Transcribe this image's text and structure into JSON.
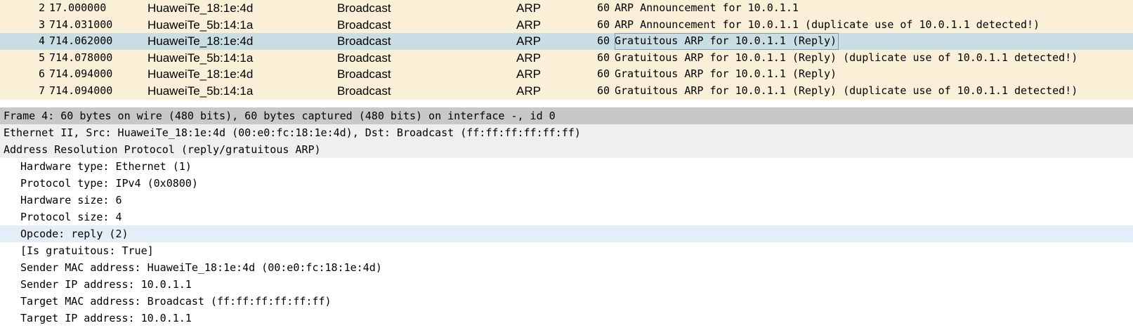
{
  "packets": [
    {
      "no": "2",
      "time": "17.000000",
      "source": "HuaweiTe_18:1e:4d",
      "destination": "Broadcast",
      "protocol": "ARP",
      "length": "60",
      "info": "ARP Announcement for 10.0.1.1",
      "selected": false
    },
    {
      "no": "3",
      "time": "714.031000",
      "source": "HuaweiTe_5b:14:1a",
      "destination": "Broadcast",
      "protocol": "ARP",
      "length": "60",
      "info": "ARP Announcement for 10.0.1.1 (duplicate use of 10.0.1.1 detected!)",
      "selected": false
    },
    {
      "no": "4",
      "time": "714.062000",
      "source": "HuaweiTe_18:1e:4d",
      "destination": "Broadcast",
      "protocol": "ARP",
      "length": "60",
      "info": "Gratuitous ARP for 10.0.1.1 (Reply)",
      "selected": true
    },
    {
      "no": "5",
      "time": "714.078000",
      "source": "HuaweiTe_5b:14:1a",
      "destination": "Broadcast",
      "protocol": "ARP",
      "length": "60",
      "info": "Gratuitous ARP for 10.0.1.1 (Reply) (duplicate use of 10.0.1.1 detected!)",
      "selected": false
    },
    {
      "no": "6",
      "time": "714.094000",
      "source": "HuaweiTe_18:1e:4d",
      "destination": "Broadcast",
      "protocol": "ARP",
      "length": "60",
      "info": "Gratuitous ARP for 10.0.1.1 (Reply)",
      "selected": false
    },
    {
      "no": "7",
      "time": "714.094000",
      "source": "HuaweiTe_5b:14:1a",
      "destination": "Broadcast",
      "protocol": "ARP",
      "length": "60",
      "info": "Gratuitous ARP for 10.0.1.1 (Reply) (duplicate use of 10.0.1.1 detected!)",
      "selected": false
    }
  ],
  "details": {
    "frame": "Frame 4: 60 bytes on wire (480 bits), 60 bytes captured (480 bits) on interface -, id 0",
    "ethernet": "Ethernet II, Src: HuaweiTe_18:1e:4d (00:e0:fc:18:1e:4d), Dst: Broadcast (ff:ff:ff:ff:ff:ff)",
    "arp": "Address Resolution Protocol (reply/gratuitous ARP)",
    "fields": [
      {
        "text": "Hardware type: Ethernet (1)",
        "highlighted": false
      },
      {
        "text": "Protocol type: IPv4 (0x0800)",
        "highlighted": false
      },
      {
        "text": "Hardware size: 6",
        "highlighted": false
      },
      {
        "text": "Protocol size: 4",
        "highlighted": false
      },
      {
        "text": "Opcode: reply (2)",
        "highlighted": true
      },
      {
        "text": "[Is gratuitous: True]",
        "highlighted": false
      },
      {
        "text": "Sender MAC address: HuaweiTe_18:1e:4d (00:e0:fc:18:1e:4d)",
        "highlighted": false
      },
      {
        "text": "Sender IP address: 10.0.1.1",
        "highlighted": false
      },
      {
        "text": "Target MAC address: Broadcast (ff:ff:ff:ff:ff:ff)",
        "highlighted": false
      },
      {
        "text": "Target IP address: 10.0.1.1",
        "highlighted": false
      }
    ]
  }
}
